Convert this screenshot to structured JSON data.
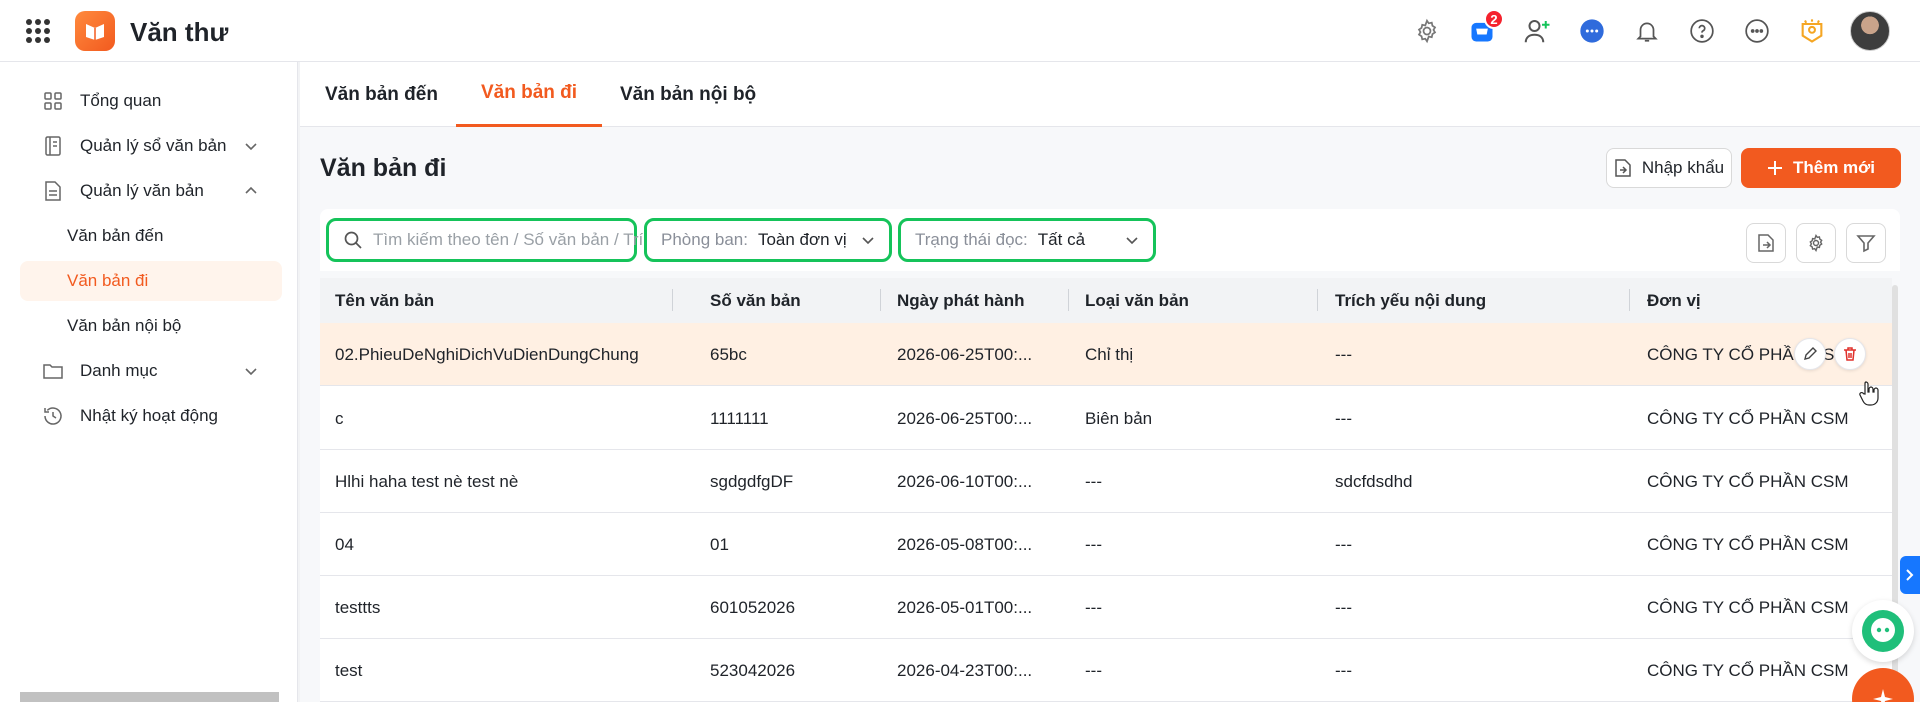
{
  "app": {
    "title": "Văn thư"
  },
  "header": {
    "cart_badge": "2",
    "icons": [
      "settings-icon",
      "cart-icon",
      "add-user-icon",
      "chat-icon",
      "bell-icon",
      "help-icon",
      "more-icon",
      "award-icon"
    ]
  },
  "sidebar": {
    "items": [
      {
        "label": "Tổng quan",
        "icon": "dashboard-icon"
      },
      {
        "label": "Quản lý sổ văn bản",
        "icon": "book-icon",
        "expanded": false
      },
      {
        "label": "Quản lý văn bản",
        "icon": "document-icon",
        "expanded": true
      },
      {
        "label": "Danh mục",
        "icon": "folder-icon",
        "expanded": false
      },
      {
        "label": "Nhật ký hoạt động",
        "icon": "history-icon"
      }
    ],
    "subitems": [
      {
        "label": "Văn bản đến",
        "active": false
      },
      {
        "label": "Văn bản đi",
        "active": true
      },
      {
        "label": "Văn bản nội bộ",
        "active": false
      }
    ]
  },
  "tabs": [
    {
      "label": "Văn bản đến",
      "active": false
    },
    {
      "label": "Văn bản đi",
      "active": true
    },
    {
      "label": "Văn bản nội bộ",
      "active": false
    }
  ],
  "page": {
    "title": "Văn bản đi",
    "import_label": "Nhập khẩu",
    "add_label": "Thêm mới"
  },
  "filters": {
    "search_placeholder": "Tìm kiếm theo tên / Số văn bản / Trích yếu",
    "department_label": "Phòng ban:",
    "department_value": "Toàn đơn vị",
    "status_label": "Trạng thái đọc:",
    "status_value": "Tất cả"
  },
  "table": {
    "columns": [
      "Tên văn bản",
      "Số văn bản",
      "Ngày phát hành",
      "Loại văn bản",
      "Trích yếu nội dung",
      "Đơn vị"
    ],
    "rows": [
      [
        "02.PhieuDeNghiDichVuDienDungChung",
        "65bc",
        "2026-06-25T00:...",
        "Chỉ thị",
        "---",
        "CÔNG TY CỔ PHẦN CSM"
      ],
      [
        "c",
        "1111111",
        "2026-06-25T00:...",
        "Biên bản",
        "---",
        "CÔNG TY CỔ PHẦN CSM"
      ],
      [
        "Hlhi haha test nè test nè",
        "sgdgdfgDF",
        "2026-06-10T00:...",
        "---",
        "sdcfdsdhd",
        "CÔNG TY CỔ PHẦN CSM"
      ],
      [
        "04",
        "01",
        "2026-05-08T00:...",
        "---",
        "---",
        "CÔNG TY CỔ PHẦN CSM"
      ],
      [
        "testtts",
        "601052026",
        "2026-05-01T00:...",
        "---",
        "---",
        "CÔNG TY CỔ PHẦN CSM"
      ],
      [
        "test",
        "523042026",
        "2026-04-23T00:...",
        "---",
        "---",
        "CÔNG TY CỔ PHẦN CSM"
      ]
    ]
  },
  "colors": {
    "accent": "#f25a1f",
    "highlight": "#15c35a",
    "row_hover": "#fff0e3"
  }
}
